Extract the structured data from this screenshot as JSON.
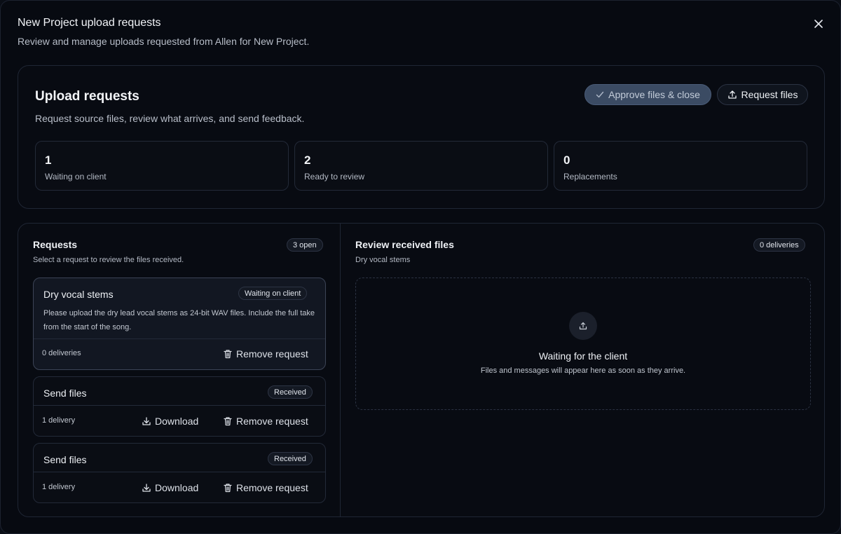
{
  "modal": {
    "title": "New Project upload requests",
    "subtitle": "Review and manage uploads requested from Allen for New Project."
  },
  "summary": {
    "title": "Upload requests",
    "subtitle": "Request source files, review what arrives, and send feedback.",
    "approve_label": "Approve files & close",
    "request_label": "Request files",
    "stats": [
      {
        "value": "1",
        "label": "Waiting on client"
      },
      {
        "value": "2",
        "label": "Ready to review"
      },
      {
        "value": "0",
        "label": "Replacements"
      }
    ]
  },
  "requests": {
    "title": "Requests",
    "subtitle": "Select a request to review the files received.",
    "badge": "3 open",
    "items": [
      {
        "title": "Dry vocal stems",
        "status": "Waiting on client",
        "description": "Please upload the dry lead vocal stems as 24-bit WAV files. Include the full take from the start of the song.",
        "deliveries": "0 deliveries",
        "remove_label": "Remove request"
      },
      {
        "title": "Send files",
        "status": "Received",
        "deliveries": "1 delivery",
        "download_label": "Download",
        "remove_label": "Remove request"
      },
      {
        "title": "Send files",
        "status": "Received",
        "deliveries": "1 delivery",
        "download_label": "Download",
        "remove_label": "Remove request"
      }
    ]
  },
  "review": {
    "title": "Review received files",
    "subtitle": "Dry vocal stems",
    "badge": "0 deliveries",
    "empty_title": "Waiting for the client",
    "empty_subtitle": "Files and messages will appear here as soon as they arrive."
  },
  "icons": {
    "close": "close-icon",
    "check": "check-icon",
    "upload": "upload-icon",
    "trash": "trash-icon",
    "download": "download-icon"
  },
  "colors": {
    "background": "#070a11",
    "approve_button": "#3b4b63",
    "selected_card": "#121722"
  }
}
